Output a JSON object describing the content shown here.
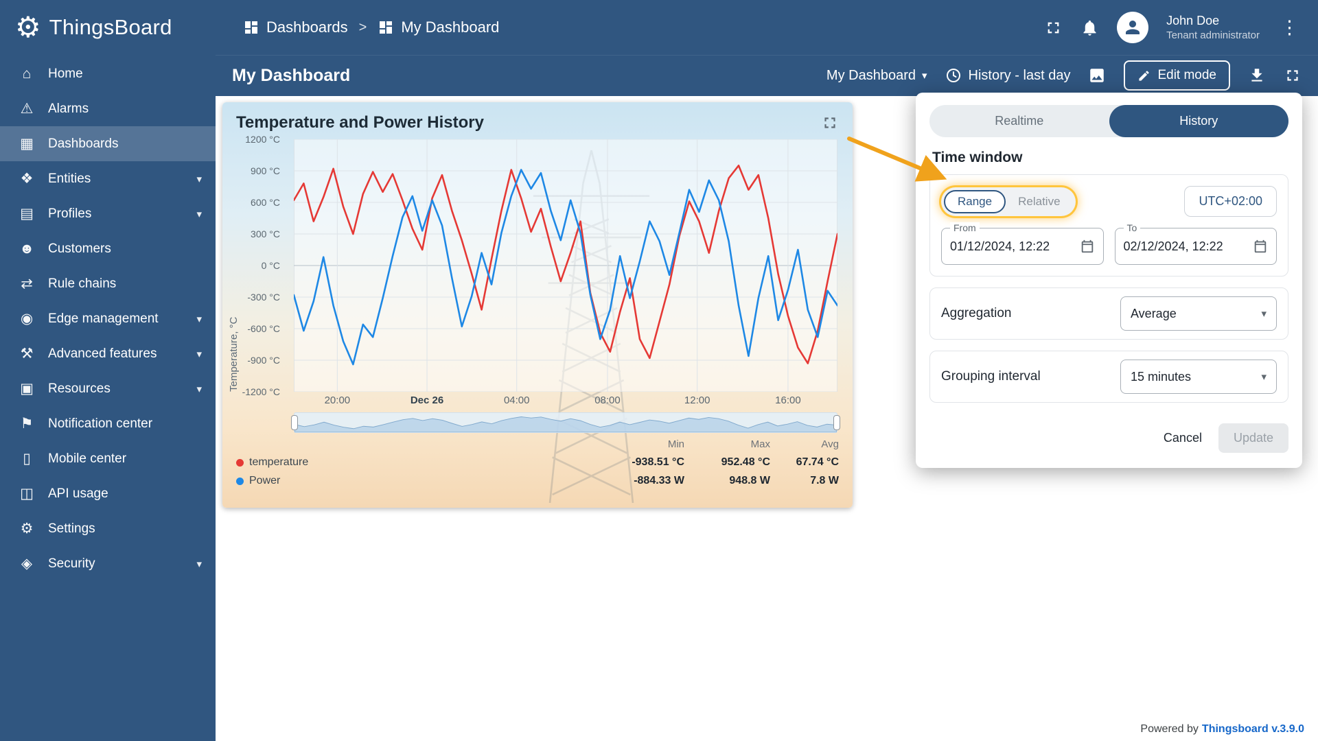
{
  "brand": {
    "name": "ThingsBoard",
    "logo_glyph": "⚙"
  },
  "ui": {
    "dropdown_arrow": "▾",
    "menu_dots": "⋮"
  },
  "header": {
    "separator": ">",
    "breadcrumbs": [
      {
        "label": "Dashboards"
      },
      {
        "label": "My Dashboard"
      }
    ],
    "user": {
      "name": "John Doe",
      "role": "Tenant administrator"
    }
  },
  "sidebar": {
    "chevron": "▾",
    "items": [
      {
        "id": "home",
        "label": "Home",
        "glyph": "⌂",
        "active": false,
        "expandable": false
      },
      {
        "id": "alarms",
        "label": "Alarms",
        "glyph": "⚠",
        "active": false,
        "expandable": false
      },
      {
        "id": "dashboards",
        "label": "Dashboards",
        "glyph": "▦",
        "active": true,
        "expandable": false
      },
      {
        "id": "entities",
        "label": "Entities",
        "glyph": "❖",
        "active": false,
        "expandable": true
      },
      {
        "id": "profiles",
        "label": "Profiles",
        "glyph": "▤",
        "active": false,
        "expandable": true
      },
      {
        "id": "customers",
        "label": "Customers",
        "glyph": "☻",
        "active": false,
        "expandable": false
      },
      {
        "id": "rule-chains",
        "label": "Rule chains",
        "glyph": "⇄",
        "active": false,
        "expandable": false
      },
      {
        "id": "edge-management",
        "label": "Edge management",
        "glyph": "◉",
        "active": false,
        "expandable": true
      },
      {
        "id": "advanced-features",
        "label": "Advanced features",
        "glyph": "⚒",
        "active": false,
        "expandable": true
      },
      {
        "id": "resources",
        "label": "Resources",
        "glyph": "▣",
        "active": false,
        "expandable": true
      },
      {
        "id": "notification-center",
        "label": "Notification center",
        "glyph": "⚑",
        "active": false,
        "expandable": false
      },
      {
        "id": "mobile-center",
        "label": "Mobile center",
        "glyph": "▯",
        "active": false,
        "expandable": false
      },
      {
        "id": "api-usage",
        "label": "API usage",
        "glyph": "◫",
        "active": false,
        "expandable": false
      },
      {
        "id": "settings",
        "label": "Settings",
        "glyph": "⚙",
        "active": false,
        "expandable": false
      },
      {
        "id": "security",
        "label": "Security",
        "glyph": "◈",
        "active": false,
        "expandable": true
      }
    ]
  },
  "toolbar": {
    "title": "My Dashboard",
    "dashboard_select": "My Dashboard",
    "history_label": "History - last day",
    "edit_mode_label": "Edit mode"
  },
  "widget": {
    "title": "Temperature and Power History",
    "legend": {
      "headers": [
        "Min",
        "Max",
        "Avg"
      ],
      "rows": [
        {
          "name": "temperature",
          "color": "#e53935",
          "min": "-938.51 °C",
          "max": "952.48 °C",
          "avg": "67.74 °C"
        },
        {
          "name": "Power",
          "color": "#1e88e5",
          "min": "-884.33 W",
          "max": "948.8 W",
          "avg": "7.8 W"
        }
      ]
    }
  },
  "chart_data": {
    "type": "line",
    "title": "Temperature and Power History",
    "xlabel": "",
    "ylabel": "Temperature, °C",
    "ylim": [
      -1200,
      1200
    ],
    "grid": true,
    "legend_position": "bottom",
    "ytick_values": [
      1200,
      900,
      600,
      300,
      0,
      -300,
      -600,
      -900,
      -1200
    ],
    "ytick_labels": [
      "1200 °C",
      "900 °C",
      "600 °C",
      "300 °C",
      "0 °C",
      "-300 °C",
      "-600 °C",
      "-900 °C",
      "-1200 °C"
    ],
    "xticks": [
      {
        "pos": 8,
        "label": "20:00",
        "bold": false
      },
      {
        "pos": 24.5,
        "label": "Dec 26",
        "bold": true
      },
      {
        "pos": 41,
        "label": "04:00",
        "bold": false
      },
      {
        "pos": 57.7,
        "label": "08:00",
        "bold": false
      },
      {
        "pos": 74.2,
        "label": "12:00",
        "bold": false
      },
      {
        "pos": 90.9,
        "label": "16:00",
        "bold": false
      }
    ],
    "series": [
      {
        "name": "temperature",
        "unit": "°C",
        "color": "#e53935",
        "values": [
          620,
          780,
          420,
          650,
          920,
          560,
          300,
          680,
          890,
          700,
          870,
          620,
          350,
          150,
          640,
          860,
          520,
          240,
          -80,
          -420,
          60,
          520,
          910,
          640,
          320,
          540,
          180,
          -150,
          120,
          420,
          -260,
          -640,
          -820,
          -440,
          -120,
          -700,
          -880,
          -530,
          -180,
          280,
          610,
          420,
          120,
          520,
          830,
          950,
          720,
          860,
          450,
          -80,
          -480,
          -780,
          -930,
          -620,
          -150,
          300
        ]
      },
      {
        "name": "Power",
        "unit": "W",
        "color": "#1e88e5",
        "values": [
          -280,
          -620,
          -340,
          80,
          -380,
          -720,
          -940,
          -560,
          -680,
          -310,
          90,
          460,
          660,
          330,
          620,
          380,
          -120,
          -580,
          -290,
          120,
          -180,
          310,
          660,
          910,
          730,
          880,
          520,
          240,
          620,
          310,
          -280,
          -700,
          -420,
          90,
          -310,
          40,
          420,
          230,
          -90,
          310,
          720,
          510,
          810,
          620,
          230,
          -380,
          -860,
          -310,
          90,
          -520,
          -230,
          150,
          -420,
          -680,
          -240,
          -380
        ]
      }
    ]
  },
  "popup": {
    "tabs": [
      {
        "label": "Realtime",
        "active": false
      },
      {
        "label": "History",
        "active": true
      }
    ],
    "section_title": "Time window",
    "interval_toggle": [
      {
        "label": "Range",
        "selected": true
      },
      {
        "label": "Relative",
        "selected": false
      }
    ],
    "timezone": "UTC+02:00",
    "from": {
      "label": "From",
      "value": "01/12/2024, 12:22"
    },
    "to": {
      "label": "To",
      "value": "02/12/2024, 12:22"
    },
    "aggregation": {
      "label": "Aggregation",
      "value": "Average"
    },
    "grouping": {
      "label": "Grouping interval",
      "value": "15 minutes"
    },
    "cancel_label": "Cancel",
    "update_label": "Update"
  },
  "footer": {
    "powered_by": "Powered by",
    "version": "Thingsboard v.3.9.0"
  }
}
